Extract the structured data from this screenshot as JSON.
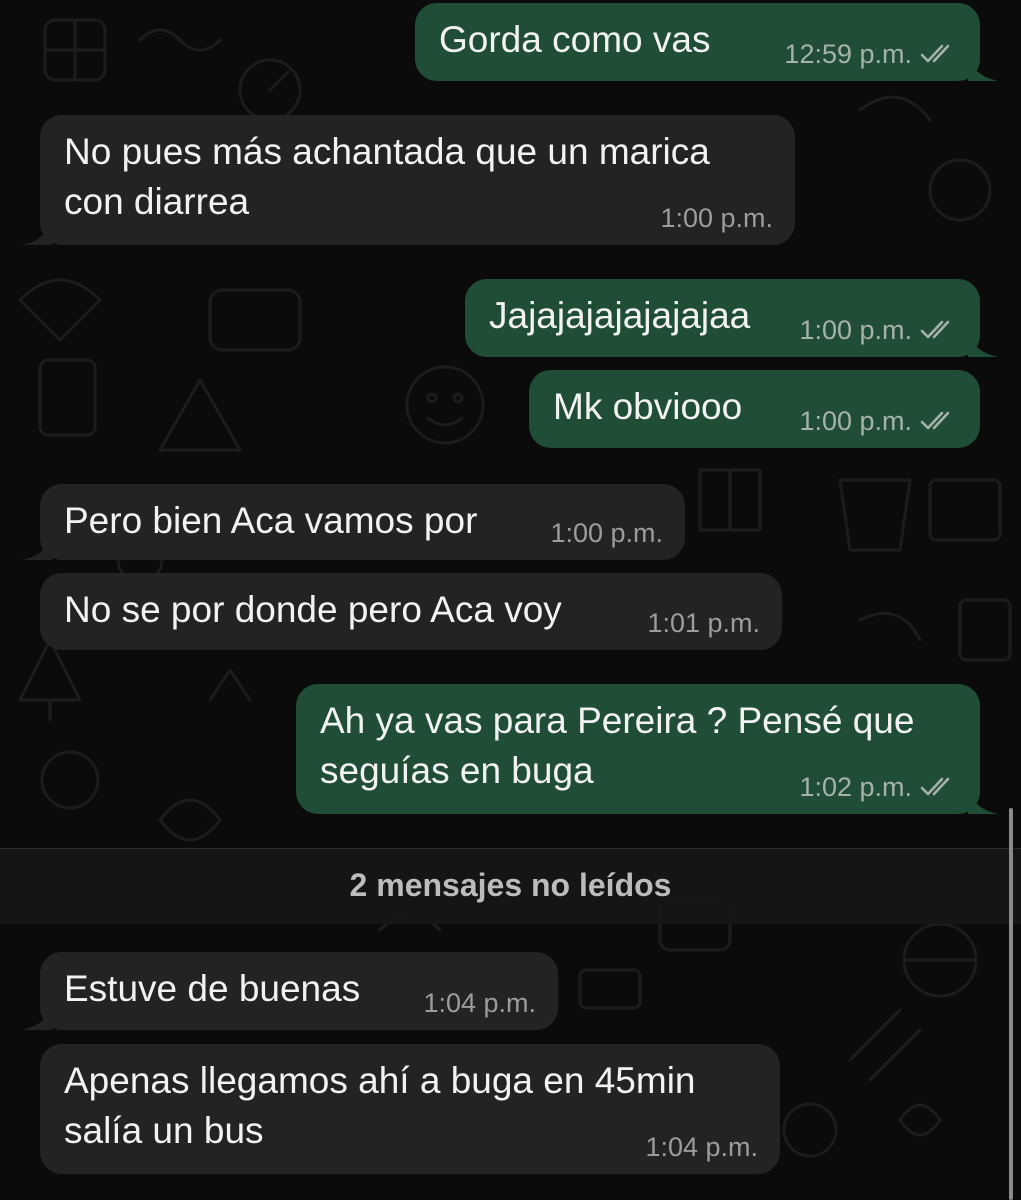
{
  "theme": {
    "outgoing_bubble_color": "#1f4d36",
    "incoming_bubble_color": "#222324",
    "background_color": "#0b0b0b"
  },
  "messages": [
    {
      "direction": "out",
      "lines": [
        "Gorda como  vas"
      ],
      "time": "12:59 p.m.",
      "status": "read"
    },
    {
      "direction": "in",
      "lines": [
        "No pues más achantada que un marica",
        "con diarrea"
      ],
      "time": "1:00 p.m."
    },
    {
      "direction": "out",
      "lines": [
        "Jajajajajajajajaa"
      ],
      "time": "1:00 p.m.",
      "status": "read"
    },
    {
      "direction": "out",
      "lines": [
        "Mk obviooo"
      ],
      "time": "1:00 p.m.",
      "status": "read"
    },
    {
      "direction": "in",
      "lines": [
        "Pero bien Aca vamos por"
      ],
      "time": "1:00 p.m."
    },
    {
      "direction": "in",
      "lines": [
        "No se por donde pero Aca voy"
      ],
      "time": "1:01 p.m."
    },
    {
      "direction": "out",
      "lines": [
        "Ah ya vas para Pereira ? Pensé que",
        "seguías en buga"
      ],
      "time": "1:02 p.m.",
      "status": "read"
    },
    {
      "direction": "in",
      "lines": [
        "Estuve de buenas"
      ],
      "time": "1:04 p.m."
    },
    {
      "direction": "in",
      "lines": [
        "Apenas llegamos ahí a buga en 45min",
        "salía un bus"
      ],
      "time": "1:04 p.m."
    }
  ],
  "unread_divider": {
    "label": "2 mensajes no leídos"
  }
}
